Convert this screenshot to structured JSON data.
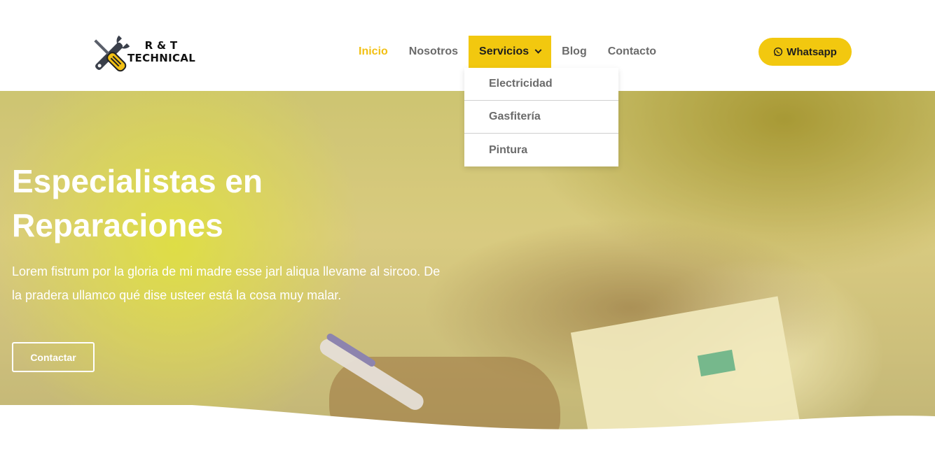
{
  "brand": {
    "line1": "R & T",
    "line2": "TECHNICAL",
    "logo_icon": "wrench-screwdriver-icon"
  },
  "nav": {
    "items": [
      {
        "label": "Inicio",
        "state": "active"
      },
      {
        "label": "Nosotros",
        "state": "normal"
      },
      {
        "label": "Servicios",
        "state": "open"
      },
      {
        "label": "Blog",
        "state": "normal"
      },
      {
        "label": "Contacto",
        "state": "normal"
      }
    ],
    "dropdown": [
      "Electricidad",
      "Gasfitería",
      "Pintura"
    ]
  },
  "whatsapp": {
    "label": "Whatsapp",
    "icon": "whatsapp-icon"
  },
  "hero": {
    "title_line1": "Especialistas en",
    "title_line2": "Reparaciones",
    "text_line1": "Lorem fistrum por la gloria de mi madre esse jarl aliqua llevame al sircoo. De",
    "text_line2": "la pradera ullamco qué dise usteer está la cosa muy malar.",
    "button": "Contactar"
  },
  "colors": {
    "accent": "#f2c80f",
    "active_link": "#f2c014",
    "nav_text": "#6b6b6b"
  }
}
